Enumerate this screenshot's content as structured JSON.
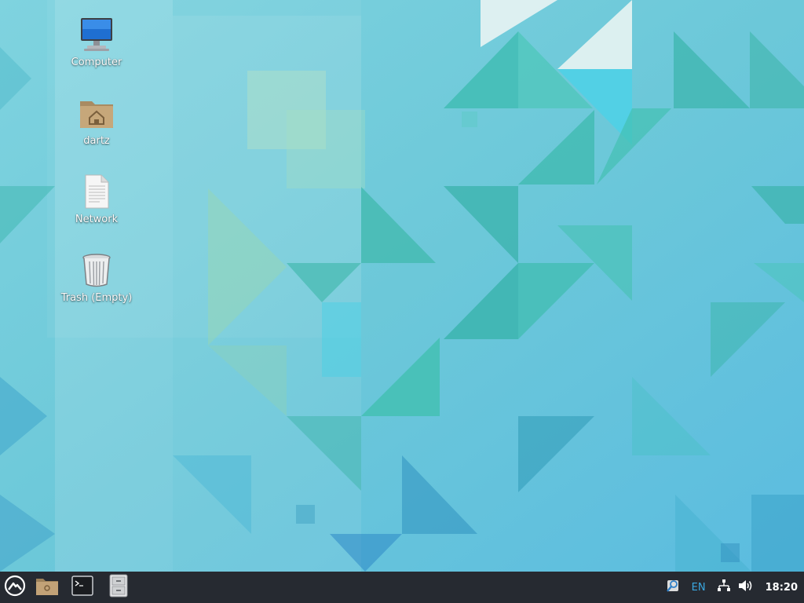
{
  "desktop": {
    "icons": [
      {
        "label": "Computer",
        "icon": "computer-icon"
      },
      {
        "label": "dartz",
        "icon": "home-folder-icon"
      },
      {
        "label": "Network",
        "icon": "document-icon"
      },
      {
        "label": "Trash (Empty)",
        "icon": "trash-icon"
      }
    ]
  },
  "taskbar": {
    "launchers": [
      {
        "name": "app-menu",
        "icon": "app-menu-icon"
      },
      {
        "name": "file-manager",
        "icon": "folder-icon"
      },
      {
        "name": "terminal",
        "icon": "terminal-icon"
      },
      {
        "name": "file-cabinet",
        "icon": "file-cabinet-icon"
      }
    ],
    "tray": {
      "search_icon": "search-tool-icon",
      "language": "EN",
      "network_icon": "network-icon",
      "volume_icon": "volume-icon",
      "clock": "18:20"
    }
  },
  "colors": {
    "taskbar_bg": "#262a31",
    "language_accent": "#3aa7e0",
    "wallpaper_base": "#6ccad8"
  }
}
